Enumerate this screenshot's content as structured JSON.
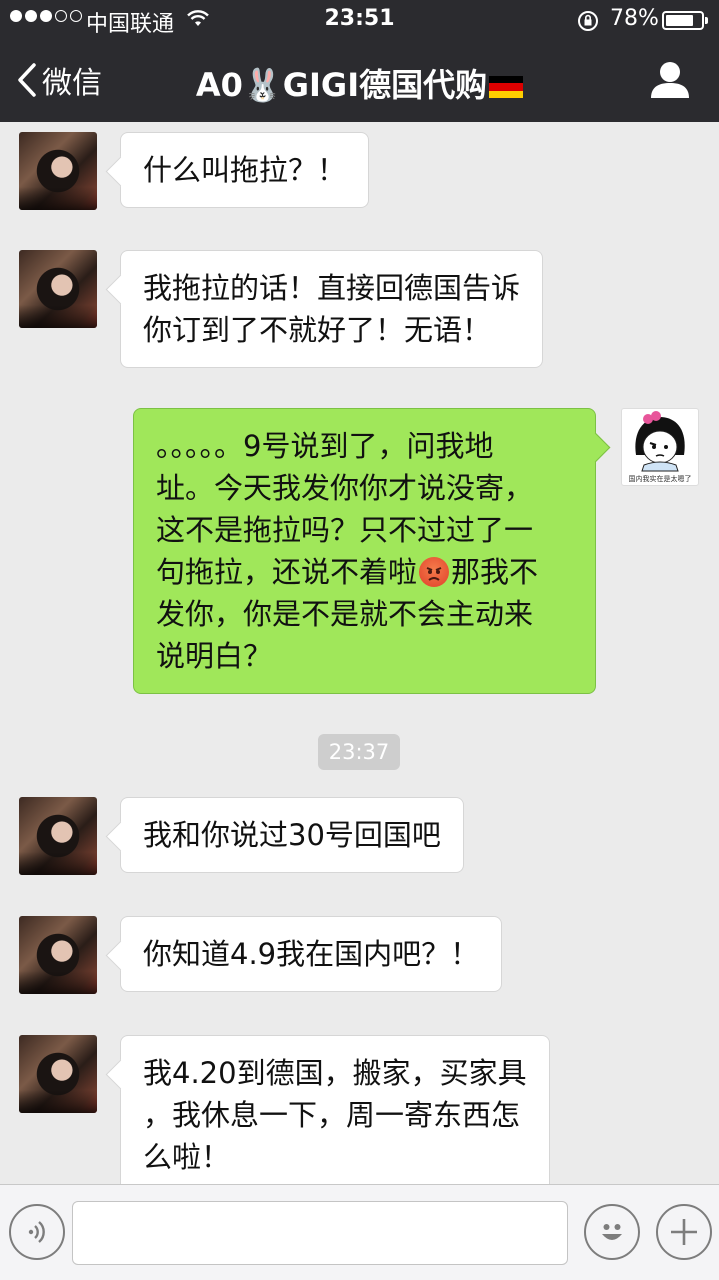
{
  "status_bar": {
    "carrier": "中国联通",
    "time": "23:51",
    "battery_percent": "78%",
    "battery_level": 0.78,
    "signal_strength": 3,
    "signal_max": 5
  },
  "nav": {
    "back_label": "微信",
    "title": "A0🐰GIGI德国代购",
    "flag": "german-flag-icon"
  },
  "messages": [
    {
      "side": "left",
      "text": "什么叫拖拉？！"
    },
    {
      "side": "left",
      "text": "我拖拉的话！直接回德国告诉\n你订到了不就好了！无语！"
    },
    {
      "side": "right",
      "text_before": "。。。。。9号说到了，问我地\n址。今天我发你你才说没寄，\n这不是拖拉吗？只不过过了一\n句拖拉，还说不着啦",
      "emoji": "angry-face-emoji",
      "text_after": "那我不\n发你，你是不是就不会主动来\n说明白？",
      "sticker_caption": "国内我实在是太嗯了"
    },
    {
      "side": "left",
      "text": "我和你说过30号回国吧"
    },
    {
      "side": "left",
      "text": "你知道4.9我在国内吧？！"
    },
    {
      "side": "left",
      "text": "我4.20到德国，搬家，买家具\n，我休息一下，周一寄东西怎\n么啦！"
    }
  ],
  "timestamp": "23:37",
  "input": {
    "voice_icon": "voice-icon",
    "emoji_icon": "emoji-icon",
    "plus_icon": "plus-icon"
  },
  "colors": {
    "nav_bg": "#2b2b2f",
    "chat_bg": "#ebebeb",
    "sent_bubble": "#a0e75a",
    "received_bubble": "#ffffff"
  }
}
